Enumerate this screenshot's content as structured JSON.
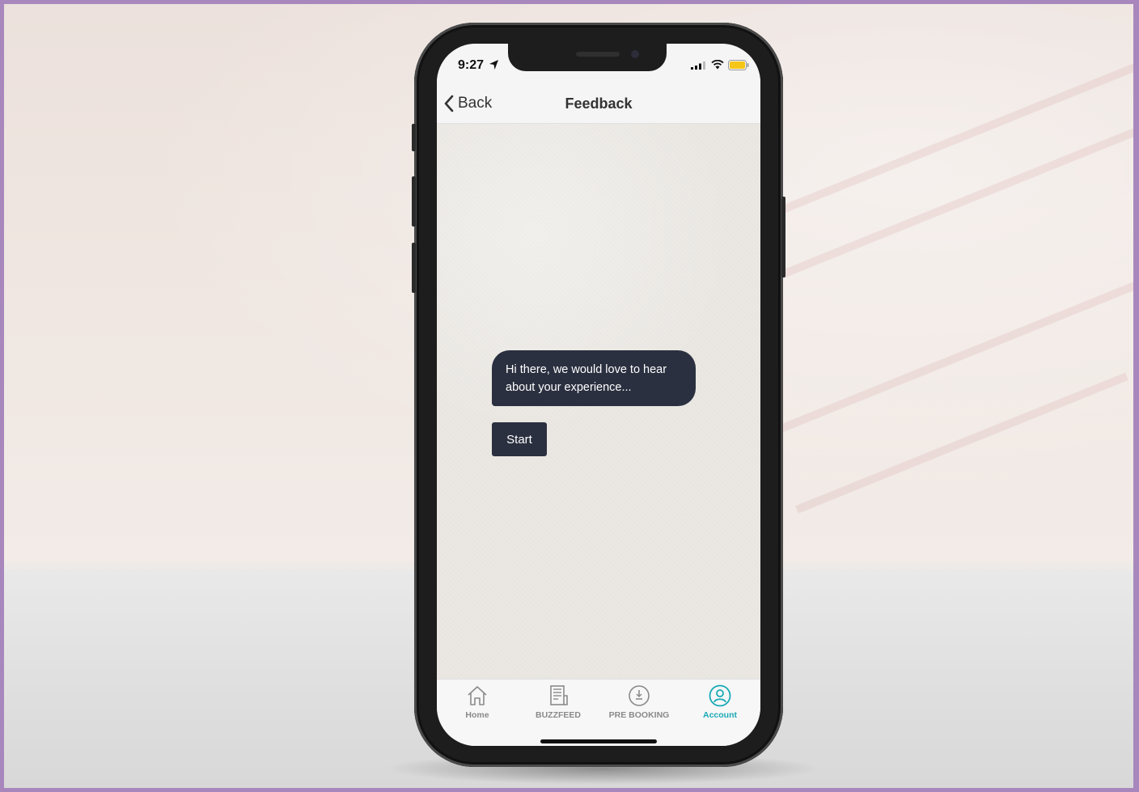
{
  "status_bar": {
    "time": "9:27"
  },
  "nav": {
    "back_label": "Back",
    "title": "Feedback"
  },
  "chat": {
    "message": "Hi there, we would love to hear about your experience...",
    "start_label": "Start"
  },
  "tabs": [
    {
      "label": "Home",
      "icon": "home-icon"
    },
    {
      "label": "BUZZFEED",
      "icon": "newspaper-icon"
    },
    {
      "label": "PRE BOOKING",
      "icon": "clock-icon"
    },
    {
      "label": "Account",
      "icon": "user-icon",
      "active": true
    }
  ],
  "colors": {
    "frame": "#a887bd",
    "accent": "#1aa9b5",
    "bubble": "#2b3040",
    "battery": "#f5c518"
  }
}
